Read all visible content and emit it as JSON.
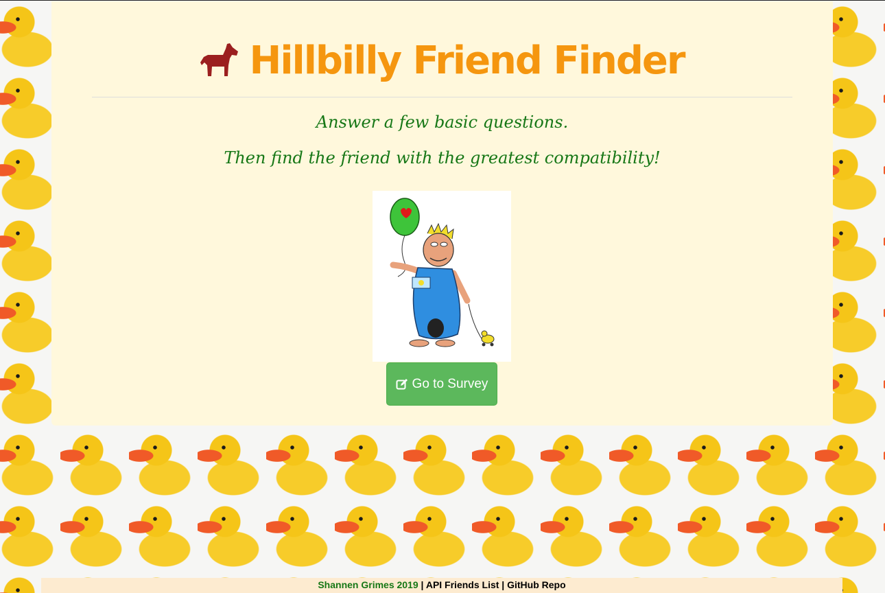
{
  "header": {
    "title": "Hillbilly Friend Finder",
    "icon": "horse-icon",
    "title_color": "#f5960f"
  },
  "intro": {
    "line1": "Answer a few basic questions.",
    "line2": "Then find the friend with the greatest compatibility!"
  },
  "illustration": {
    "description_icon": "hillbilly-cartoon-with-balloon"
  },
  "survey_button": {
    "label": "Go to Survey",
    "icon": "edit-icon",
    "color": "#5cb85c"
  },
  "footer": {
    "author": "Shannen Grimes 2019",
    "separator": "|",
    "api_link": "API Friends List",
    "repo_link": "GitHub Repo"
  }
}
